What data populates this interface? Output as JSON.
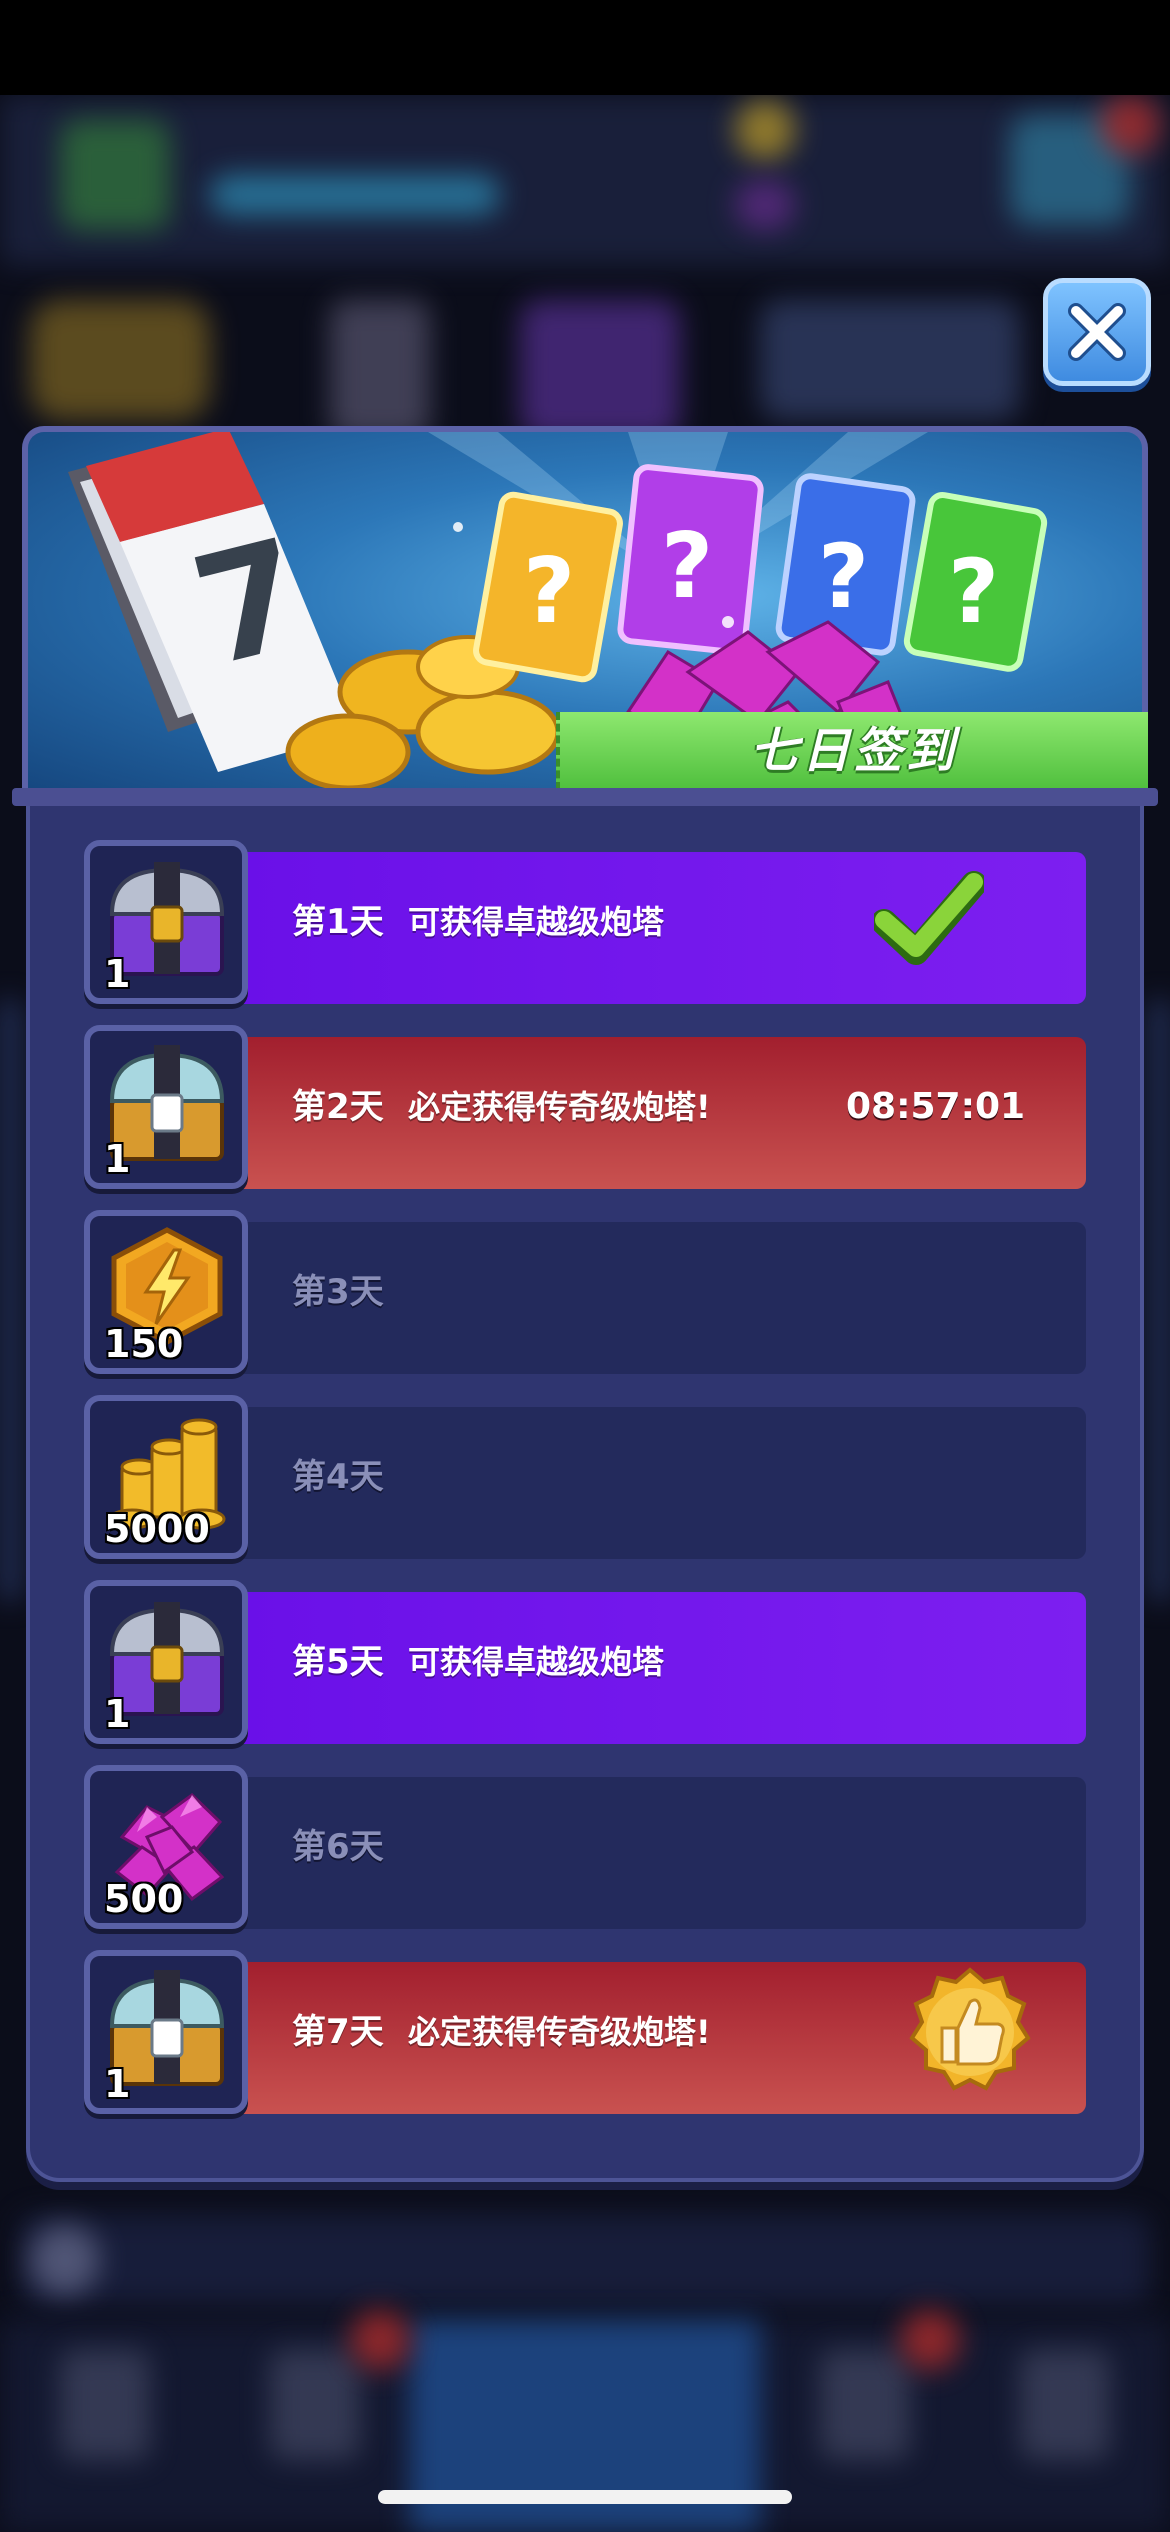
{
  "dialog": {
    "title": "七日签到",
    "banner_calendar_number": "7",
    "close_icon": "close-icon"
  },
  "rows": [
    {
      "day": "第1天",
      "desc": "可获得卓越级炮塔",
      "qty": "1",
      "reward_icon": "purple-chest-icon",
      "style": "purple",
      "status": "claimed",
      "status_icon": "checkmark-icon"
    },
    {
      "day": "第2天",
      "desc": "必定获得传奇级炮塔!",
      "qty": "1",
      "reward_icon": "legendary-chest-icon",
      "style": "red",
      "status": "countdown",
      "timer": "08:57:01"
    },
    {
      "day": "第3天",
      "desc": "",
      "qty": "150",
      "reward_icon": "energy-hexagon-icon",
      "style": "dark",
      "status": "locked"
    },
    {
      "day": "第4天",
      "desc": "",
      "qty": "5000",
      "reward_icon": "gold-coins-icon",
      "style": "dark",
      "status": "locked"
    },
    {
      "day": "第5天",
      "desc": "可获得卓越级炮塔",
      "qty": "1",
      "reward_icon": "purple-chest-icon",
      "style": "purple",
      "status": "locked"
    },
    {
      "day": "第6天",
      "desc": "",
      "qty": "500",
      "reward_icon": "gems-icon",
      "style": "dark",
      "status": "locked"
    },
    {
      "day": "第7天",
      "desc": "必定获得传奇级炮塔!",
      "qty": "1",
      "reward_icon": "legendary-chest-icon",
      "style": "red",
      "status": "locked",
      "status_icon": "thumbs-up-badge-icon"
    }
  ],
  "colors": {
    "purple_bar": "#6a10e8",
    "red_bar": "#a21f2e",
    "dark_bar": "#232a5c",
    "panel": "#2f3570",
    "title_green": "#6fd957"
  }
}
